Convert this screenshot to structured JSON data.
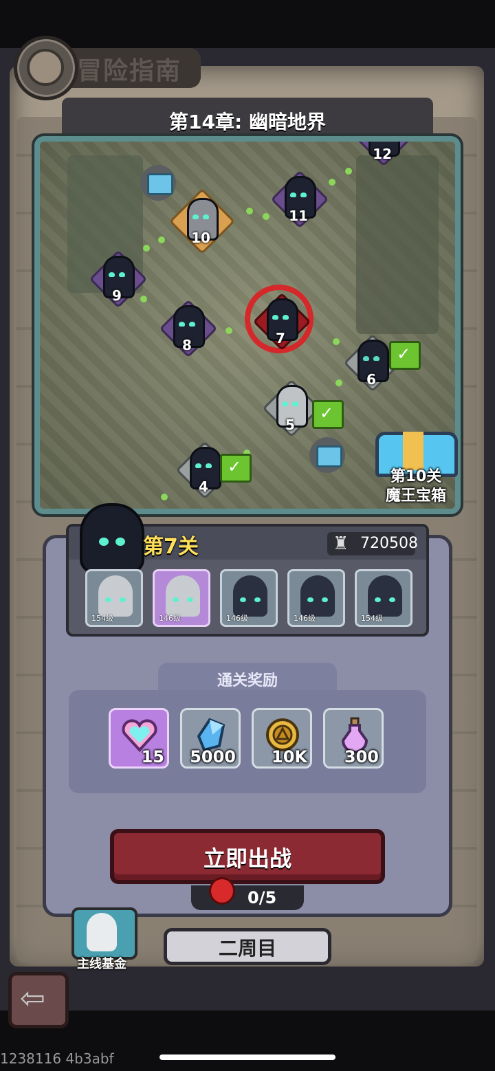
{
  "header": {
    "title": "冒险指南"
  },
  "chapter": {
    "title": "第14章: 幽暗地界"
  },
  "map": {
    "nodes": [
      {
        "label": "12",
        "state": "locked"
      },
      {
        "label": "11",
        "state": "locked"
      },
      {
        "label": "10",
        "state": "boss"
      },
      {
        "label": "9",
        "state": "locked"
      },
      {
        "label": "8",
        "state": "locked"
      },
      {
        "label": "7",
        "state": "current"
      },
      {
        "label": "6",
        "state": "cleared"
      },
      {
        "label": "5",
        "state": "cleared"
      },
      {
        "label": "4",
        "state": "cleared"
      }
    ],
    "big_chest_label_line1": "第10关",
    "big_chest_label_line2": "魔王宝箱"
  },
  "level": {
    "title": "第7关",
    "power": "720508",
    "enemies": [
      {
        "level": "154级",
        "style": "armored"
      },
      {
        "level": "146级",
        "style": "armored-purple"
      },
      {
        "level": "146级",
        "style": "hooded"
      },
      {
        "level": "146级",
        "style": "hooded"
      },
      {
        "level": "154级",
        "style": "hooded"
      }
    ]
  },
  "rewards": {
    "title": "通关奖励",
    "items": [
      {
        "icon": "heart-crystal-icon",
        "qty": "15"
      },
      {
        "icon": "blue-crystal-icon",
        "qty": "5000"
      },
      {
        "icon": "gold-coin-icon",
        "qty": "10K"
      },
      {
        "icon": "pink-potion-icon",
        "qty": "300"
      }
    ]
  },
  "actions": {
    "fight_label": "立即出战",
    "stamina": "0/5",
    "fund_label": "主线基金",
    "cycle_label": "二周目"
  },
  "footer": {
    "build": "1238116 4b3abf"
  },
  "colors": {
    "accent_yellow": "#ffe05a",
    "enemy_eye": "#5ff0d0",
    "fight_button": "#8c2a34",
    "map_border": "#5c8c8c",
    "cleared_flag": "#6cc431"
  }
}
